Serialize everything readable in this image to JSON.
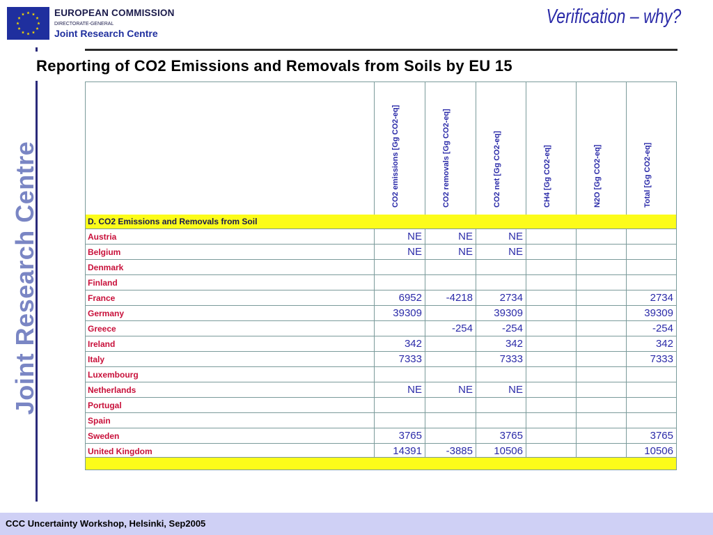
{
  "header": {
    "org_name": "EUROPEAN COMMISSION",
    "org_dg": "DIRECTORATE-GENERAL",
    "org_jrc": "Joint Research Centre",
    "slide_title": "Verification – why?"
  },
  "sidebar": {
    "vertical_brand": "Joint Research Centre"
  },
  "heading": "Reporting of CO2 Emissions and Removals from Soils by EU 15",
  "table": {
    "columns": [
      "CO2 emissions [Gg CO2-eq]",
      "CO2 removals [Gg CO2-eq]",
      "CO2 net [Gg CO2-eq]",
      "CH4 [Gg CO2-eq]",
      "N2O [Gg CO2-eq]",
      "Total [Gg CO2-eq]"
    ],
    "section_label": "D.  CO2 Emissions and Removals from Soil",
    "rows": [
      {
        "country": "Austria",
        "values": [
          "NE",
          "NE",
          "NE",
          "",
          "",
          ""
        ]
      },
      {
        "country": "Belgium",
        "values": [
          "NE",
          "NE",
          "NE",
          "",
          "",
          ""
        ]
      },
      {
        "country": "Denmark",
        "values": [
          "",
          "",
          "",
          "",
          "",
          ""
        ]
      },
      {
        "country": "Finland",
        "values": [
          "",
          "",
          "",
          "",
          "",
          ""
        ]
      },
      {
        "country": "France",
        "values": [
          "6952",
          "-4218",
          "2734",
          "",
          "",
          "2734"
        ]
      },
      {
        "country": "Germany",
        "values": [
          "39309",
          "",
          "39309",
          "",
          "",
          "39309"
        ]
      },
      {
        "country": "Greece",
        "values": [
          "",
          "-254",
          "-254",
          "",
          "",
          "-254"
        ]
      },
      {
        "country": "Ireland",
        "values": [
          "342",
          "",
          "342",
          "",
          "",
          "342"
        ]
      },
      {
        "country": "Italy",
        "values": [
          "7333",
          "",
          "7333",
          "",
          "",
          "7333"
        ]
      },
      {
        "country": "Luxembourg",
        "values": [
          "",
          "",
          "",
          "",
          "",
          ""
        ]
      },
      {
        "country": "Netherlands",
        "values": [
          "NE",
          "NE",
          "NE",
          "",
          "",
          ""
        ]
      },
      {
        "country": "Portugal",
        "values": [
          "",
          "",
          "",
          "",
          "",
          ""
        ]
      },
      {
        "country": "Spain",
        "values": [
          "",
          "",
          "",
          "",
          "",
          ""
        ]
      },
      {
        "country": "Sweden",
        "values": [
          "3765",
          "",
          "3765",
          "",
          "",
          "3765"
        ]
      },
      {
        "country": "United Kingdom",
        "values": [
          "14391",
          "-3885",
          "10506",
          "",
          "",
          "10506"
        ]
      }
    ]
  },
  "footer": {
    "text": "CCC Uncertainty Workshop, Helsinki, Sep2005"
  },
  "colors": {
    "accent": "#2a2aa8",
    "country_text": "#c8103a",
    "section_fill": "#fcfc1a",
    "footer_bar": "#cfd0f5",
    "brand_vertical": "#7a86c4"
  }
}
